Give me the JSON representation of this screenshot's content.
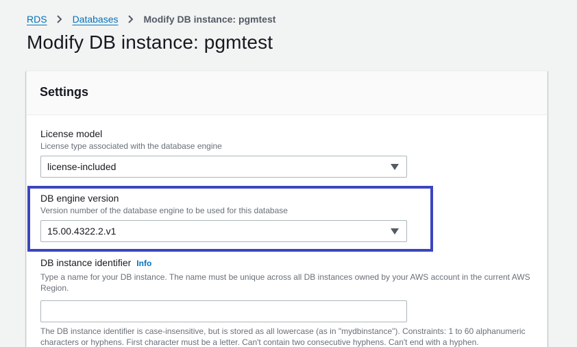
{
  "breadcrumb": {
    "items": [
      {
        "label": "RDS"
      },
      {
        "label": "Databases"
      }
    ],
    "current": "Modify DB instance: pgmtest"
  },
  "page": {
    "title": "Modify DB instance: pgmtest"
  },
  "settings": {
    "title": "Settings",
    "license_model": {
      "label": "License model",
      "description": "License type associated with the database engine",
      "value": "license-included"
    },
    "engine_version": {
      "label": "DB engine version",
      "description": "Version number of the database engine to be used for this database",
      "value": "15.00.4322.2.v1"
    },
    "instance_identifier": {
      "label": "DB instance identifier",
      "info": "Info",
      "description": "Type a name for your DB instance. The name must be unique across all DB instances owned by your AWS account in the current AWS Region.",
      "value": "",
      "constraint": "The DB instance identifier is case-insensitive, but is stored as all lowercase (as in \"mydbinstance\"). Constraints: 1 to 60 alphanumeric characters or hyphens. First character must be a letter. Can't contain two consecutive hyphens. Can't end with a hyphen."
    }
  },
  "colors": {
    "link": "#0073bb",
    "highlight": "#3b45bf",
    "background": "#f2f3f3"
  }
}
